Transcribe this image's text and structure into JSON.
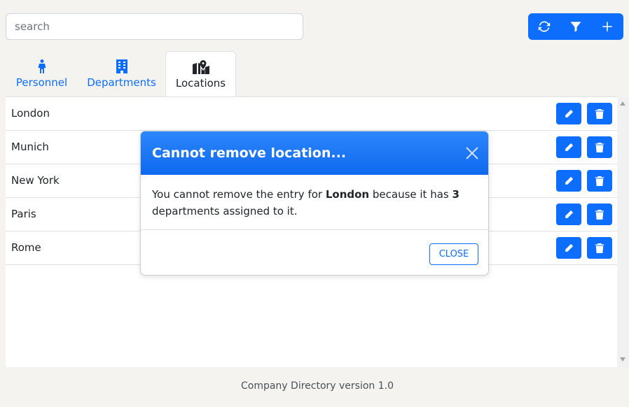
{
  "search": {
    "placeholder": "search"
  },
  "toolbar": {
    "refresh_icon": "refresh-icon",
    "filter_icon": "filter-icon",
    "add_icon": "plus-icon"
  },
  "tabs": [
    {
      "label": "Personnel",
      "icon": "person-icon"
    },
    {
      "label": "Departments",
      "icon": "building-icon"
    },
    {
      "label": "Locations",
      "icon": "map-location-icon",
      "active": true
    }
  ],
  "locations": [
    {
      "name": "London"
    },
    {
      "name": "Munich"
    },
    {
      "name": "New York"
    },
    {
      "name": "Paris"
    },
    {
      "name": "Rome"
    }
  ],
  "modal": {
    "title": "Cannot remove location...",
    "body_prefix": "You cannot remove the entry for ",
    "location_name": "London",
    "body_middle": " because it has ",
    "dept_count": "3",
    "body_suffix": " departments assigned to it.",
    "close_label": "CLOSE"
  },
  "footer": {
    "text": "Company Directory version 1.0"
  },
  "colors": {
    "primary": "#0d6efd",
    "background": "#f5f3ef"
  }
}
